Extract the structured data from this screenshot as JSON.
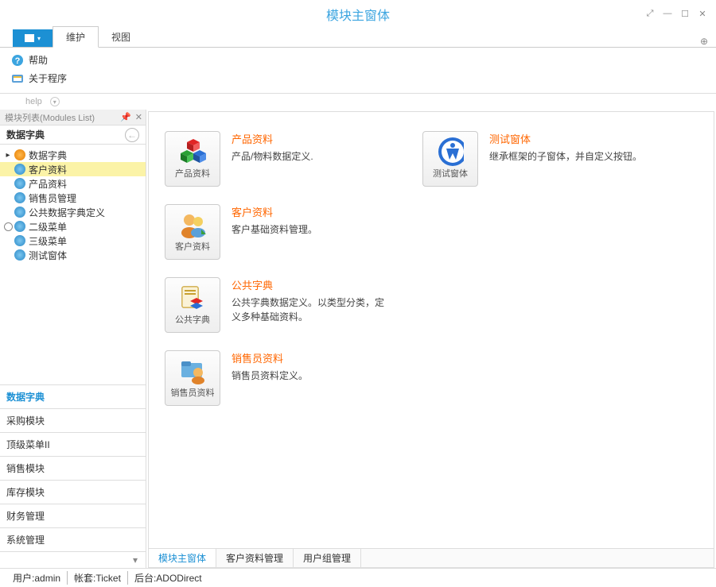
{
  "window": {
    "title": "模块主窗体"
  },
  "ribbon": {
    "tabs": [
      "维护",
      "视图"
    ],
    "active_tab": "维护",
    "items": [
      {
        "label": "帮助",
        "icon": "help"
      },
      {
        "label": "关于程序",
        "icon": "about"
      }
    ],
    "group_caption": "help"
  },
  "sidebar": {
    "title": "模块列表(Modules List)",
    "section_header": "数据字典",
    "tree": {
      "root": {
        "label": "数据字典"
      },
      "children": [
        {
          "label": "客户资料",
          "selected": true
        },
        {
          "label": "产品资料"
        },
        {
          "label": "销售员管理"
        },
        {
          "label": "公共数据字典定义"
        }
      ],
      "sub_root": {
        "label": "二级菜单"
      },
      "sub_children": [
        {
          "label": "三级菜单"
        }
      ],
      "tail": {
        "label": "测试窗体"
      }
    },
    "bottom_groups": [
      "数据字典",
      "采购模块",
      "顶级菜单II",
      "销售模块",
      "库存模块",
      "财务管理",
      "系统管理"
    ],
    "active_group": "数据字典"
  },
  "content": {
    "modules_col1": [
      {
        "id": "product",
        "title": "产品资料",
        "desc": "产品/物料数据定义.",
        "caption": "产品资料"
      },
      {
        "id": "customer",
        "title": "客户资料",
        "desc": "客户基础资料管理。",
        "caption": "客户资料"
      },
      {
        "id": "dict",
        "title": "公共字典",
        "desc": "公共字典数据定义。以类型分类，定义多种基础资料。",
        "caption": "公共字典"
      },
      {
        "id": "sales",
        "title": "销售员资料",
        "desc": "销售员资料定义。",
        "caption": "销售员资料"
      }
    ],
    "modules_col2": [
      {
        "id": "test",
        "title": "测试窗体",
        "desc": "继承框架的子窗体，并自定义按钮。",
        "caption": "测试窗体"
      }
    ],
    "tabs": [
      "模块主窗体",
      "客户资料管理",
      "用户组管理"
    ],
    "active_tab": "模块主窗体"
  },
  "status": {
    "user_label": "用户:",
    "user": "admin",
    "acct_label": "帐套:",
    "acct": "Ticket",
    "backend_label": "后台:",
    "backend": "ADODirect"
  }
}
